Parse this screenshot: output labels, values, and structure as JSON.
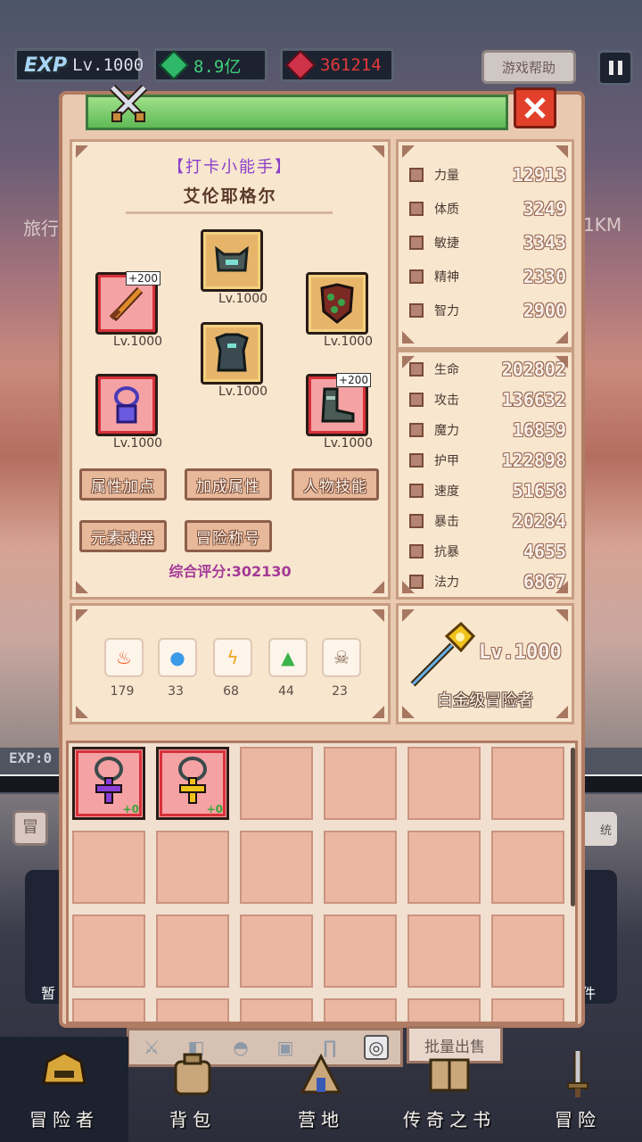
{
  "top_bar": {
    "exp_logo": "EXP",
    "level": "Lv.1000",
    "green_currency": "8.9亿",
    "red_currency": "361214",
    "help_button": "游戏帮助"
  },
  "background": {
    "travel_label": "旅行",
    "distance_label": "1KM",
    "exp_label": "EXP:0",
    "left_side_label": "冒",
    "right_side_label": "统",
    "bottom_left_label": "暂",
    "bottom_right_label": "件"
  },
  "hero": {
    "title": "【打卡小能手】",
    "name": "艾伦耶格尔",
    "equipment": [
      {
        "slot": "weapon",
        "level": "Lv.1000",
        "plus": "+200",
        "rarity": "red"
      },
      {
        "slot": "helmet",
        "level": "Lv.1000",
        "plus": "",
        "rarity": "gold"
      },
      {
        "slot": "shield",
        "level": "Lv.1000",
        "plus": "",
        "rarity": "gold"
      },
      {
        "slot": "armor",
        "level": "Lv.1000",
        "plus": "",
        "rarity": "gold"
      },
      {
        "slot": "necklace",
        "level": "Lv.1000",
        "plus": "",
        "rarity": "red"
      },
      {
        "slot": "boots",
        "level": "Lv.1000",
        "plus": "+200",
        "rarity": "red"
      }
    ],
    "buttons": [
      "属性加点",
      "加成属性",
      "人物技能",
      "元素魂器",
      "冒险称号"
    ],
    "score": "综合评分:302130"
  },
  "base_stats": [
    {
      "name": "力量",
      "value": "12913"
    },
    {
      "name": "体质",
      "value": "3249"
    },
    {
      "name": "敏捷",
      "value": "3343"
    },
    {
      "name": "精神",
      "value": "2330"
    },
    {
      "name": "智力",
      "value": "2900"
    }
  ],
  "combat_stats": [
    {
      "name": "生命",
      "value": "202802"
    },
    {
      "name": "攻击",
      "value": "136632"
    },
    {
      "name": "魔力",
      "value": "16859"
    },
    {
      "name": "护甲",
      "value": "122898"
    },
    {
      "name": "速度",
      "value": "51658"
    },
    {
      "name": "暴击",
      "value": "20284"
    },
    {
      "name": "抗暴",
      "value": "4655"
    },
    {
      "name": "法力",
      "value": "6867"
    }
  ],
  "elements": [
    {
      "icon": "fire-icon",
      "value": "179",
      "color": "#f0521c"
    },
    {
      "icon": "water-icon",
      "value": "33",
      "color": "#3a9ae8"
    },
    {
      "icon": "lightning-icon",
      "value": "68",
      "color": "#f0a61c"
    },
    {
      "icon": "earth-icon",
      "value": "44",
      "color": "#3ab34a"
    },
    {
      "icon": "skull-icon",
      "value": "23",
      "color": "#8a6a5a"
    }
  ],
  "rank": {
    "level": "Lv.1000",
    "name": "白金级冒险者"
  },
  "inventory": {
    "items": [
      {
        "icon": "purple-cross-necklace-icon",
        "plus": "+0",
        "color": "#8a3fd8"
      },
      {
        "icon": "gold-cross-necklace-icon",
        "plus": "+0",
        "color": "#f0c21c"
      }
    ],
    "total_visible_cells": 24
  },
  "tabs": [
    "weapon-tab-icon",
    "shield-tab-icon",
    "helmet-tab-icon",
    "armor-tab-icon",
    "pants-tab-icon",
    "ring-tab-icon"
  ],
  "sell_button": "批量出售",
  "bottom_nav": [
    {
      "label": "冒险者",
      "icon": "helmet-nav-icon",
      "active": true
    },
    {
      "label": "背包",
      "icon": "bag-nav-icon",
      "active": false
    },
    {
      "label": "营地",
      "icon": "camp-nav-icon",
      "active": false
    },
    {
      "label": "传奇之书",
      "icon": "book-nav-icon",
      "active": false
    },
    {
      "label": "冒险",
      "icon": "sword-nav-icon",
      "active": false
    }
  ]
}
